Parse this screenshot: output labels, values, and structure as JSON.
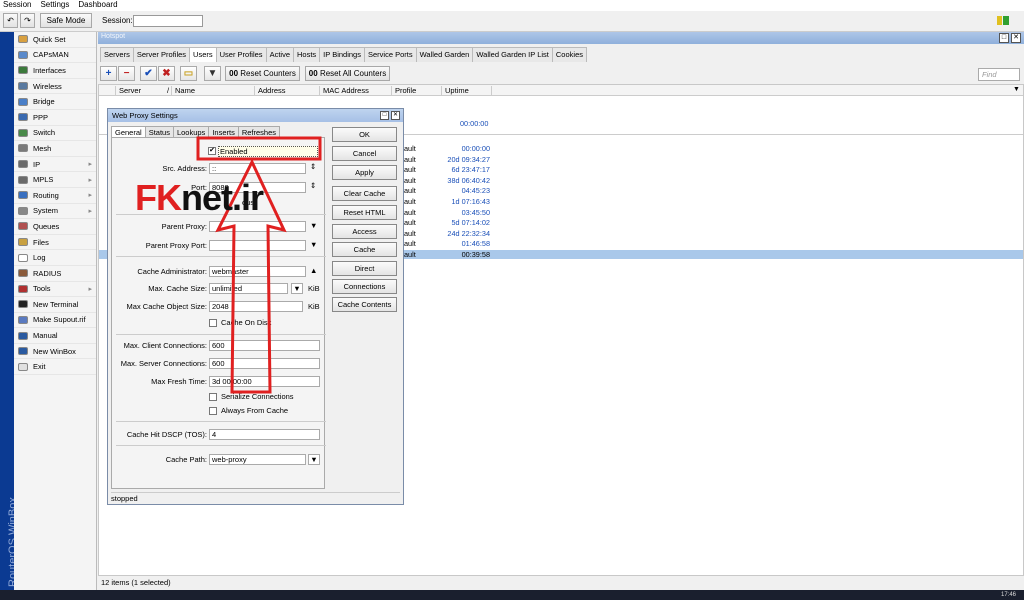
{
  "menu": [
    "Session",
    "Settings",
    "Dashboard"
  ],
  "toolbar": {
    "undo_icon": "undo-icon",
    "redo_icon": "redo-icon",
    "safe_mode": "Safe Mode",
    "session_label": "Session:",
    "session_value": ""
  },
  "sidebar": {
    "strip_text": "RouterOS WinBox",
    "items": [
      {
        "label": "Quick Set",
        "icon": "quick-set-icon",
        "color": "#d8a040"
      },
      {
        "label": "CAPsMAN",
        "icon": "capsman-icon",
        "color": "#5a8acb"
      },
      {
        "label": "Interfaces",
        "icon": "interfaces-icon",
        "color": "#3c7a3c"
      },
      {
        "label": "Wireless",
        "icon": "wireless-icon",
        "color": "#5a7aa0"
      },
      {
        "label": "Bridge",
        "icon": "bridge-icon",
        "color": "#4a7fc8"
      },
      {
        "label": "PPP",
        "icon": "ppp-icon",
        "color": "#3a6ab0"
      },
      {
        "label": "Switch",
        "icon": "switch-icon",
        "color": "#4a8a4a"
      },
      {
        "label": "Mesh",
        "icon": "mesh-icon",
        "color": "#7a7a7a"
      },
      {
        "label": "IP",
        "icon": "ip-icon",
        "color": "#6a6a6a",
        "arrow": "▸"
      },
      {
        "label": "MPLS",
        "icon": "mpls-icon",
        "color": "#6a6a6a",
        "arrow": "▸"
      },
      {
        "label": "Routing",
        "icon": "routing-icon",
        "color": "#3a70c0",
        "arrow": "▸"
      },
      {
        "label": "System",
        "icon": "system-icon",
        "color": "#888888",
        "arrow": "▸"
      },
      {
        "label": "Queues",
        "icon": "queues-icon",
        "color": "#b05050"
      },
      {
        "label": "Files",
        "icon": "files-icon",
        "color": "#c8a040"
      },
      {
        "label": "Log",
        "icon": "log-icon",
        "color": "#ffffff"
      },
      {
        "label": "RADIUS",
        "icon": "radius-icon",
        "color": "#8a5a3a"
      },
      {
        "label": "Tools",
        "icon": "tools-icon",
        "color": "#b03030",
        "arrow": "▸"
      },
      {
        "label": "New Terminal",
        "icon": "terminal-icon",
        "color": "#222222"
      },
      {
        "label": "Make Supout.rif",
        "icon": "supout-icon",
        "color": "#5a7ac0"
      },
      {
        "label": "Manual",
        "icon": "manual-icon",
        "color": "#2a5aa0"
      },
      {
        "label": "New WinBox",
        "icon": "winbox-icon",
        "color": "#2a5aa0"
      },
      {
        "label": "Exit",
        "icon": "exit-icon",
        "color": "#e0e0e0"
      }
    ]
  },
  "window": {
    "title": "Hotspot",
    "tabs": [
      "Servers",
      "Server Profiles",
      "Users",
      "User Profiles",
      "Active",
      "Hosts",
      "IP Bindings",
      "Service Ports",
      "Walled Garden",
      "Walled Garden IP List",
      "Cookies"
    ],
    "active_tab": "Users",
    "reset_counters": "Reset Counters",
    "reset_all_counters": "Reset All Counters",
    "counter_mark": "00",
    "find_placeholder": "Find",
    "columns": [
      "Server",
      "/",
      "Name",
      "Address",
      "MAC Address",
      "Profile",
      "Uptime"
    ],
    "top_uptime": "00:00:00",
    "profile_fragment": "ault",
    "uptimes": [
      "00:00:00",
      "20d 09:34:27",
      "6d 23:47:17",
      "38d 06:40:42",
      "04:45:23",
      "1d 07:16:43",
      "03:45:50",
      "5d 07:14:02",
      "24d 22:32:34",
      "01:46:58",
      "00:39:58"
    ],
    "status": "12 items (1 selected)"
  },
  "dialog": {
    "title": "Web Proxy Settings",
    "tabs": [
      "General",
      "Status",
      "Lookups",
      "Inserts",
      "Refreshes"
    ],
    "enabled": "Enabled",
    "src_address_label": "Src. Address:",
    "src_address": "::",
    "port_label": "Port:",
    "port": "8080",
    "anonymous_fragment": "ous",
    "parent_proxy_label": "Parent Proxy:",
    "parent_proxy": "",
    "parent_proxy_port_label": "Parent Proxy Port:",
    "parent_proxy_port": "",
    "cache_admin_label": "Cache Administrator:",
    "cache_admin": "webmaster",
    "max_cache_size_label": "Max. Cache Size:",
    "max_cache_size": "unlimited",
    "kib": "KiB",
    "max_cache_object_label": "Max Cache Object Size:",
    "max_cache_object": "2048",
    "cache_on_disk": "Cache On Disk",
    "max_client_label": "Max. Client Connections:",
    "max_client": "600",
    "max_server_label": "Max. Server Connections:",
    "max_server": "600",
    "max_fresh_label": "Max Fresh Time:",
    "max_fresh": "3d 00:00:00",
    "serialize": "Serialize Connections",
    "always_from_cache": "Always From Cache",
    "dscp_label": "Cache Hit DSCP (TOS):",
    "dscp": "4",
    "cache_path_label": "Cache Path:",
    "cache_path": "web-proxy",
    "buttons": [
      "OK",
      "Cancel",
      "Apply",
      "Clear Cache",
      "Reset HTML",
      "Access",
      "Cache",
      "Direct",
      "Connections",
      "Cache Contents"
    ],
    "status": "stopped"
  },
  "watermark": "FKnet.ir",
  "taskbar_time": "17:46"
}
